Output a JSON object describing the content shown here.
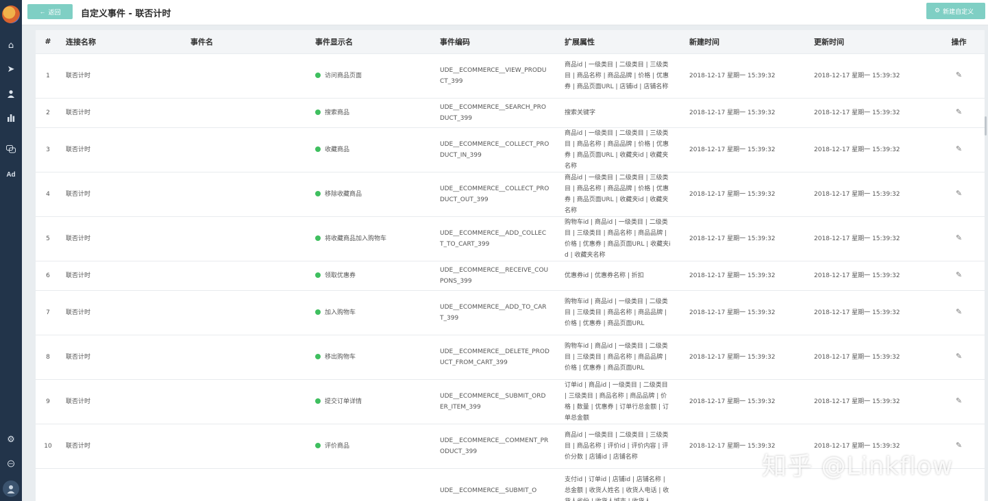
{
  "header": {
    "back_label": "返回",
    "title": "自定义事件 - 联否计时",
    "new_label": "新建自定义"
  },
  "sidebar": {
    "items": [
      {
        "icon": "home-icon"
      },
      {
        "icon": "send-icon"
      },
      {
        "icon": "user-icon"
      },
      {
        "icon": "bar-chart-icon"
      },
      {
        "icon": "chat-icon"
      },
      {
        "icon": "ad-icon",
        "label": "Ad"
      }
    ],
    "bottom": [
      {
        "icon": "gear-icon"
      },
      {
        "icon": "message-icon"
      },
      {
        "icon": "avatar-icon"
      }
    ]
  },
  "table": {
    "columns": [
      "#",
      "连接名称",
      "事件名",
      "事件显示名",
      "事件编码",
      "扩展属性",
      "新建时间",
      "更新时间",
      "操作"
    ],
    "rows": [
      {
        "no": "1",
        "conn": "联否计时",
        "event": "",
        "display": "访问商品页面",
        "code": "UDE__ECOMMERCE__VIEW_PRODUCT_399",
        "attrs": "商品id | 一级类目 | 二级类目 | 三级类目 | 商品名称 | 商品品牌 | 价格 | 优惠券 | 商品页面URL | 店铺id | 店铺名称",
        "created": "2018-12-17 星期一 15:39:32",
        "updated": "2018-12-17 星期一 15:39:32"
      },
      {
        "no": "2",
        "conn": "联否计时",
        "event": "",
        "display": "搜索商品",
        "code": "UDE__ECOMMERCE__SEARCH_PRODUCT_399",
        "attrs": "搜索关键字",
        "created": "2018-12-17 星期一 15:39:32",
        "updated": "2018-12-17 星期一 15:39:32"
      },
      {
        "no": "3",
        "conn": "联否计时",
        "event": "",
        "display": "收藏商品",
        "code": "UDE__ECOMMERCE__COLLECT_PRODUCT_IN_399",
        "attrs": "商品id | 一级类目 | 二级类目 | 三级类目 | 商品名称 | 商品品牌 | 价格 | 优惠券 | 商品页面URL | 收藏夹id | 收藏夹名称",
        "created": "2018-12-17 星期一 15:39:32",
        "updated": "2018-12-17 星期一 15:39:32"
      },
      {
        "no": "4",
        "conn": "联否计时",
        "event": "",
        "display": "移除收藏商品",
        "code": "UDE__ECOMMERCE__COLLECT_PRODUCT_OUT_399",
        "attrs": "商品id | 一级类目 | 二级类目 | 三级类目 | 商品名称 | 商品品牌 | 价格 | 优惠券 | 商品页面URL | 收藏夹id | 收藏夹名称",
        "created": "2018-12-17 星期一 15:39:32",
        "updated": "2018-12-17 星期一 15:39:32"
      },
      {
        "no": "5",
        "conn": "联否计时",
        "event": "",
        "display": "将收藏商品加入购物车",
        "code": "UDE__ECOMMERCE__ADD_COLLECT_TO_CART_399",
        "attrs": "购物车id | 商品id | 一级类目 | 二级类目 | 三级类目 | 商品名称 | 商品品牌 | 价格 | 优惠券 | 商品页面URL | 收藏夹id | 收藏夹名称",
        "created": "2018-12-17 星期一 15:39:32",
        "updated": "2018-12-17 星期一 15:39:32"
      },
      {
        "no": "6",
        "conn": "联否计时",
        "event": "",
        "display": "领取优惠券",
        "code": "UDE__ECOMMERCE__RECEIVE_COUPONS_399",
        "attrs": "优惠券id | 优惠券名称 | 折扣",
        "created": "2018-12-17 星期一 15:39:32",
        "updated": "2018-12-17 星期一 15:39:32"
      },
      {
        "no": "7",
        "conn": "联否计时",
        "event": "",
        "display": "加入购物车",
        "code": "UDE__ECOMMERCE__ADD_TO_CART_399",
        "attrs": "购物车id | 商品id | 一级类目 | 二级类目 | 三级类目 | 商品名称 | 商品品牌 | 价格 | 优惠券 | 商品页面URL",
        "created": "2018-12-17 星期一 15:39:32",
        "updated": "2018-12-17 星期一 15:39:32"
      },
      {
        "no": "8",
        "conn": "联否计时",
        "event": "",
        "display": "移出购物车",
        "code": "UDE__ECOMMERCE__DELETE_PRODUCT_FROM_CART_399",
        "attrs": "购物车id | 商品id | 一级类目 | 二级类目 | 三级类目 | 商品名称 | 商品品牌 | 价格 | 优惠券 | 商品页面URL",
        "created": "2018-12-17 星期一 15:39:32",
        "updated": "2018-12-17 星期一 15:39:32"
      },
      {
        "no": "9",
        "conn": "联否计时",
        "event": "",
        "display": "提交订单详情",
        "code": "UDE__ECOMMERCE__SUBMIT_ORDER_ITEM_399",
        "attrs": "订单id | 商品id | 一级类目 | 二级类目 | 三级类目 | 商品名称 | 商品品牌 | 价格 | 数量 | 优惠券 | 订单行总金额 | 订单总金额",
        "created": "2018-12-17 星期一 15:39:32",
        "updated": "2018-12-17 星期一 15:39:32"
      },
      {
        "no": "10",
        "conn": "联否计时",
        "event": "",
        "display": "评价商品",
        "code": "UDE__ECOMMERCE__COMMENT_PRODUCT_399",
        "attrs": "商品id | 一级类目 | 二级类目 | 三级类目 | 商品名称 | 评价id | 评价内容 | 评价分数 | 店铺id | 店铺名称",
        "created": "2018-12-17 星期一 15:39:32",
        "updated": "2018-12-17 星期一 15:39:32"
      },
      {
        "no": "",
        "conn": "",
        "event": "",
        "display": "",
        "code": "UDE__ECOMMERCE__SUBMIT_O",
        "attrs": "支付id | 订单id | 店铺id | 店铺名称 | 总金额 | 收货人姓名 | 收货人电话 | 收货人省份 | 收货人城市 | 收货人",
        "created": "",
        "updated": ""
      }
    ]
  },
  "watermark": "知乎 @Linkflow",
  "colors": {
    "accent": "#7fcfc4",
    "sidebar": "#22344a",
    "status_dot": "#3fbf5f"
  }
}
